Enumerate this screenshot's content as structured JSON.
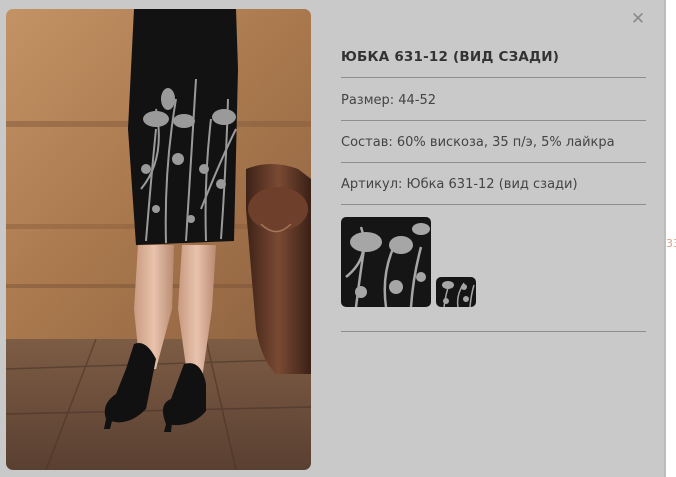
{
  "product": {
    "title": "ЮБКА 631-12 (ВИД СЗАДИ)",
    "size": "Размер: 44-52",
    "composition": "Состав: 60% вискоза, 35 п/э, 5% лайкра",
    "article": "Артикул: Юбка 631-12 (вид сзади)"
  },
  "close_icon": "close-icon",
  "background_peek_text": "33",
  "colors": {
    "overlay": "#c9c9c9",
    "title": "#333333",
    "text": "#444444",
    "rule": "#8e8e8e",
    "skirt": "#121212",
    "print": "#9a9a9a",
    "wall": "#b7865c",
    "floor": "#6b4e3a",
    "sofa": "#5a3422"
  }
}
